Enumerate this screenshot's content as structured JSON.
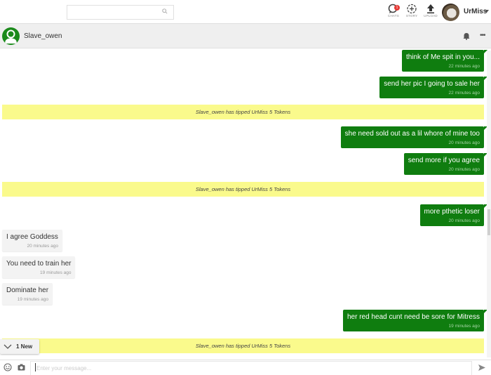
{
  "topbar": {
    "search_placeholder": "",
    "nav": [
      {
        "label": "CHATS",
        "icon": "chat-icon",
        "badge": "1"
      },
      {
        "label": "STORY",
        "icon": "story-add-icon"
      },
      {
        "label": "UPLOAD",
        "icon": "upload-icon"
      }
    ],
    "user": {
      "name": "UrMiss"
    }
  },
  "chat_header": {
    "peer_name": "Slave_owen"
  },
  "messages": [
    {
      "type": "out",
      "text": "think of Me spit in you...",
      "time": "22 minutes ago"
    },
    {
      "type": "out",
      "text": "send her pic I going to sale her",
      "time": "22 minutes ago"
    },
    {
      "type": "tip",
      "text": "Slave_owen has tipped UrMiss 5 Tokens"
    },
    {
      "type": "out",
      "text": "she need sold out as a lil whore of mine too",
      "time": "20 minutes ago"
    },
    {
      "type": "out",
      "text": "send more if you agree",
      "time": "20 minutes ago"
    },
    {
      "type": "tip",
      "text": "Slave_owen has tipped UrMiss 5 Tokens"
    },
    {
      "type": "out",
      "text": "more pthetic loser",
      "time": "20 minutes ago"
    },
    {
      "type": "in",
      "text": "I agree Goddess",
      "time": "20 minutes ago"
    },
    {
      "type": "in",
      "text": "You need to train her",
      "time": "19 minutes ago"
    },
    {
      "type": "in",
      "text": "Dominate her",
      "time": "19 minutes ago"
    },
    {
      "type": "out",
      "text": "her red head cunt need be sore for Mitress",
      "time": "19 minutes ago"
    },
    {
      "type": "tip",
      "text": "Slave_owen has tipped UrMiss 5 Tokens"
    }
  ],
  "new_indicator": {
    "label": "1 New"
  },
  "composer": {
    "placeholder": "Enter your message..."
  },
  "colors": {
    "outgoing": "#0f7d0f",
    "tip_banner": "#fafa8c",
    "incoming": "#f3f3f3"
  }
}
